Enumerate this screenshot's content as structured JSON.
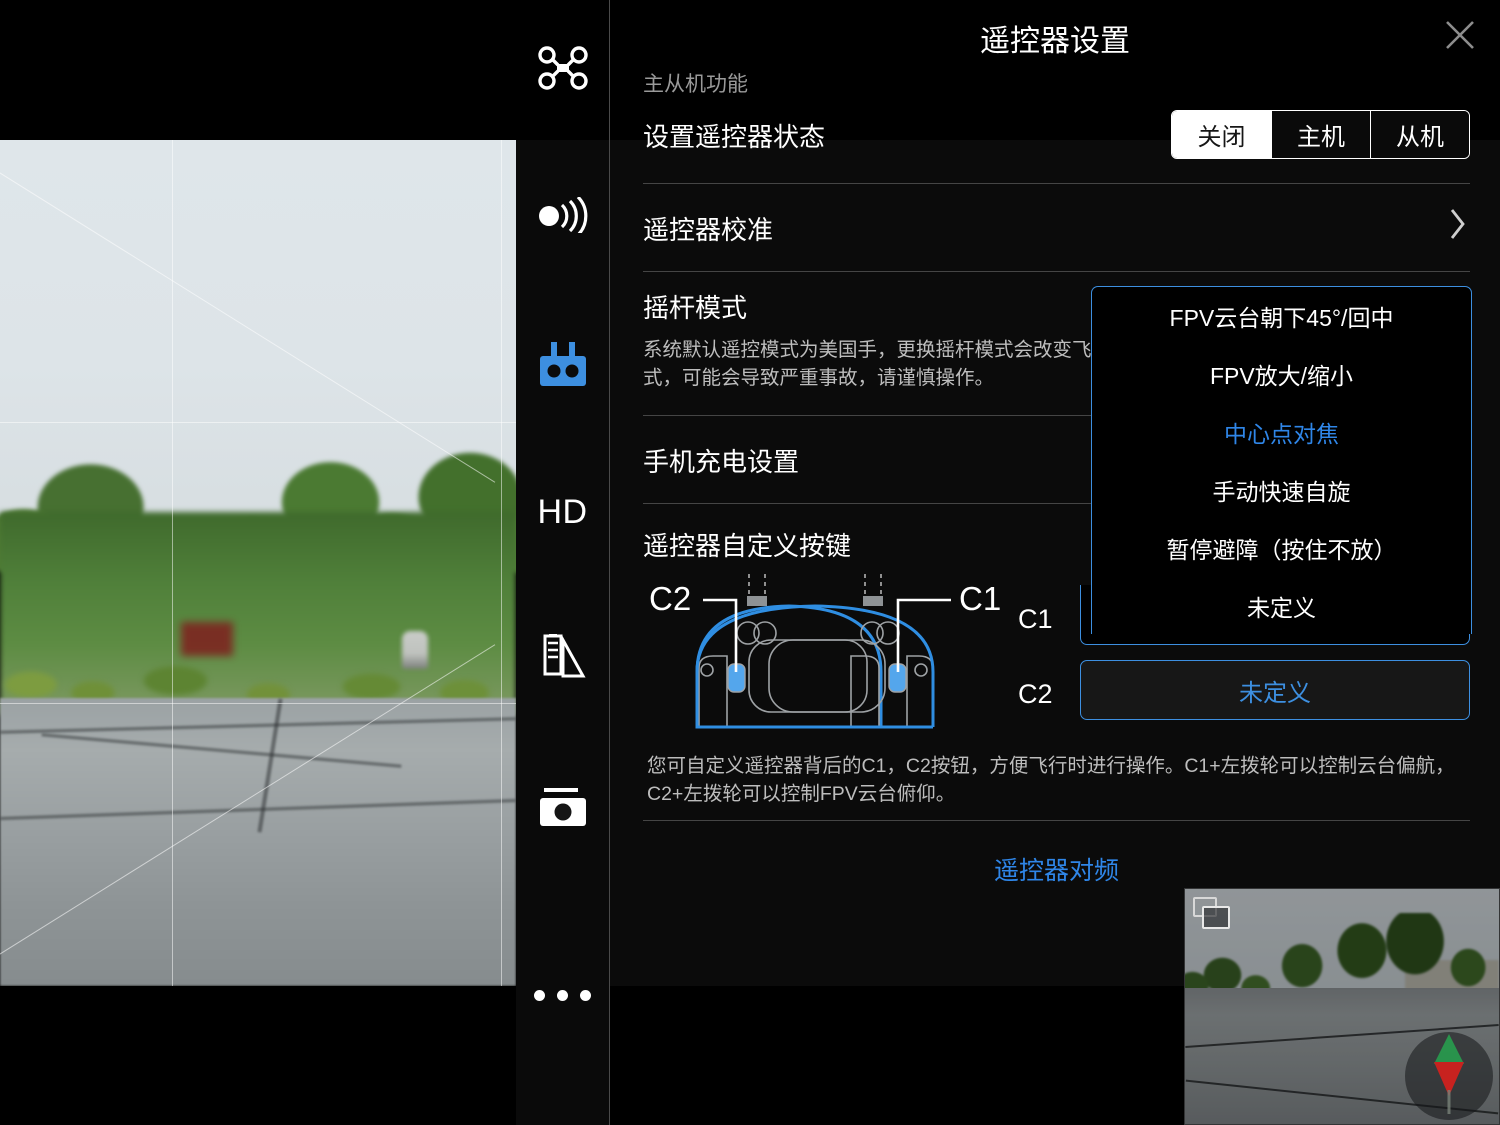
{
  "header": {
    "title": "遥控器设置",
    "close_icon": "close-icon"
  },
  "sidebar": {
    "items": [
      {
        "icon": "drone-icon",
        "label": "飞行器"
      },
      {
        "icon": "transmission-icon",
        "label": "图传"
      },
      {
        "icon": "remote-controller-icon",
        "label": "遥控器",
        "active": true,
        "color": "#3d8fe0"
      },
      {
        "icon": "hd-text-icon",
        "label": "HD"
      },
      {
        "icon": "battery-signal-icon",
        "label": "电池"
      },
      {
        "icon": "camera-icon",
        "label": "拍照"
      },
      {
        "icon": "more-dots-icon",
        "label": "更多"
      }
    ]
  },
  "panel": {
    "section_label": "主从机功能",
    "rows": {
      "rc_state": {
        "label": "设置遥控器状态",
        "options": [
          "关闭",
          "主机",
          "从机"
        ],
        "selected": "关闭"
      },
      "rc_calibration": {
        "label": "遥控器校准",
        "chevron": "chevron-right-icon"
      },
      "stick_mode": {
        "label": "摇杆模式",
        "desc": "系统默认遥控模式为美国手，更换摇杆模式会改变飞行器的飞行方式，如不熟悉所选择的操作模式，可能会导致严重事故，请谨慎操作。"
      },
      "phone_charging": {
        "label": "手机充电设置"
      },
      "custom_keys": {
        "label": "遥控器自定义按键",
        "diagram": {
          "left_callout": "C2",
          "right_callout": "C1"
        },
        "assignments": [
          {
            "key": "C1",
            "value": "未定义",
            "open": true
          },
          {
            "key": "C2",
            "value": "未定义",
            "open": false
          }
        ],
        "desc": "您可自定义遥控器背后的C1，C2按钮，方便飞行时进行操作。C1+左拨轮可以控制云台偏航，C2+左拨轮可以控制FPV云台俯仰。"
      },
      "rc_linking": {
        "link_label": "遥控器对频"
      }
    }
  },
  "dropdown": {
    "options": [
      {
        "label": "FPV云台朝下45°/回中",
        "selected": false
      },
      {
        "label": "FPV放大/缩小",
        "selected": false
      },
      {
        "label": "中心点对焦",
        "selected": true
      },
      {
        "label": "手动快速自旋",
        "selected": false
      },
      {
        "label": "暂停避障（按住不放）",
        "selected": false
      },
      {
        "label": "未定义",
        "selected": false
      }
    ]
  },
  "pip": {
    "switch_view_icon": "switch-view-icon",
    "compass_icon": "attitude-compass-icon"
  },
  "colors": {
    "accent_blue": "#3d8fe0",
    "link_blue": "#2f86e8",
    "panel_bg": "#141414",
    "text_primary": "#ffffff",
    "text_secondary": "#bdbdbd"
  }
}
